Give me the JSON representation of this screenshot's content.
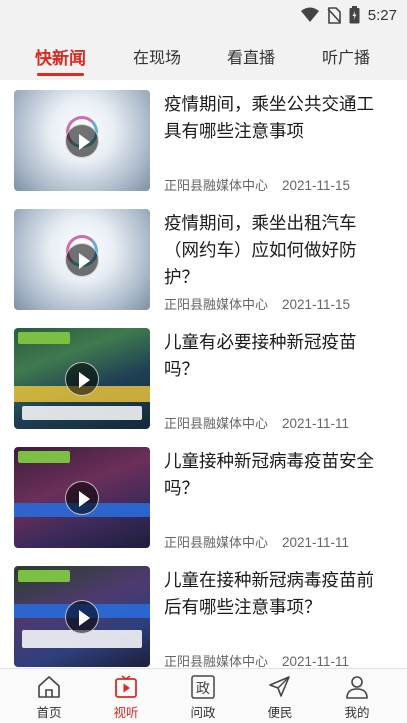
{
  "status_bar": {
    "time": "5:27",
    "icons": [
      "wifi-icon",
      "no-sim-icon",
      "battery-icon"
    ]
  },
  "tabs": [
    {
      "label": "快新闻",
      "active": true
    },
    {
      "label": "在现场",
      "active": false
    },
    {
      "label": "看直播",
      "active": false
    },
    {
      "label": "听广播",
      "active": false
    }
  ],
  "accent_color": "#d92b20",
  "news": [
    {
      "title": "疫情期间，乘坐公共交通工具有哪些注意事项",
      "source": "正阳县融媒体中心",
      "date": "2021-11-15"
    },
    {
      "title": "疫情期间，乘坐出租汽车（网约车）应如何做好防护？",
      "source": "正阳县融媒体中心",
      "date": "2021-11-15"
    },
    {
      "title": "儿童有必要接种新冠疫苗吗？",
      "source": "正阳县融媒体中心",
      "date": "2021-11-11"
    },
    {
      "title": "儿童接种新冠病毒疫苗安全吗？",
      "source": "正阳县融媒体中心",
      "date": "2021-11-11"
    },
    {
      "title": "儿童在接种新冠病毒疫苗前后有哪些注意事项？",
      "source": "正阳县融媒体中心",
      "date": "2021-11-11"
    }
  ],
  "bottom_nav": [
    {
      "label": "首页",
      "icon": "home-icon",
      "active": false
    },
    {
      "label": "视听",
      "icon": "play-icon",
      "active": true
    },
    {
      "label": "问政",
      "icon": "zheng-icon",
      "active": false
    },
    {
      "label": "便民",
      "icon": "send-icon",
      "active": false
    },
    {
      "label": "我的",
      "icon": "user-icon",
      "active": false
    }
  ]
}
